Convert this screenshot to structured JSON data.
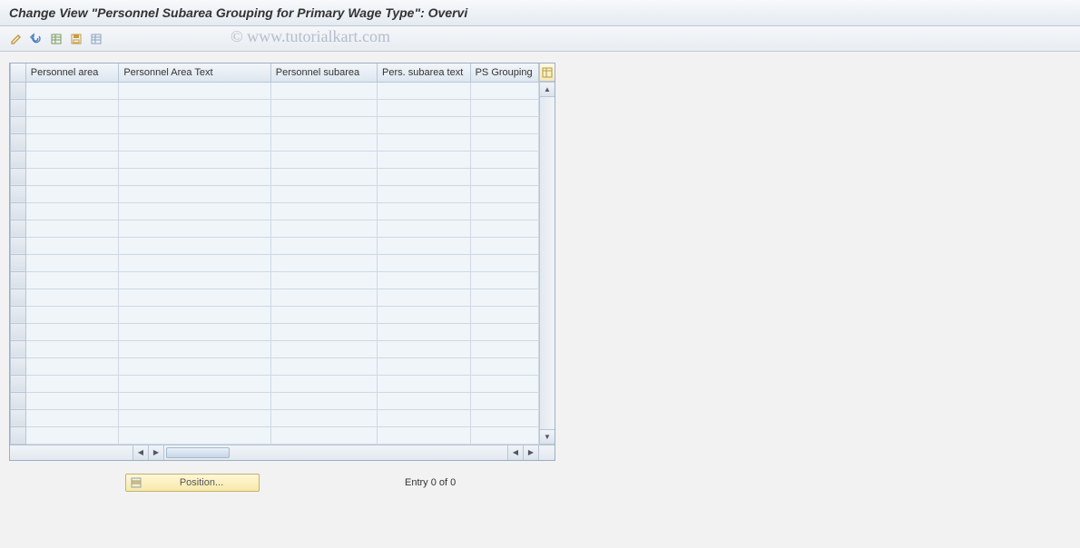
{
  "title": "Change View \"Personnel Subarea Grouping for Primary Wage Type\": Overvi",
  "watermark": "© www.tutorialkart.com",
  "toolbar": {
    "btn1_tip": "Change",
    "btn2_tip": "Undo",
    "btn3_tip": "Select All",
    "btn4_tip": "Save",
    "btn5_tip": "Deselect All"
  },
  "table": {
    "columns": [
      "Personnel area",
      "Personnel Area Text",
      "Personnel subarea",
      "Pers. subarea text",
      "PS Grouping"
    ],
    "rows": 21
  },
  "footer": {
    "position_label": "Position...",
    "entry_text": "Entry 0 of 0"
  }
}
